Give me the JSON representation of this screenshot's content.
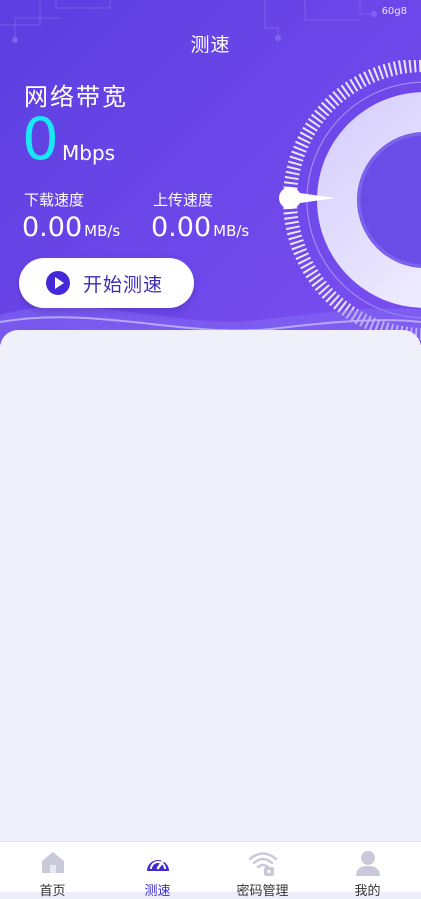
{
  "status": {
    "text": "60g8"
  },
  "header": {
    "title": "测速"
  },
  "bandwidth": {
    "label": "网络带宽",
    "value": "0",
    "unit": "Mbps"
  },
  "download": {
    "label": "下载速度",
    "value": "0.00",
    "unit": "MB/s"
  },
  "upload": {
    "label": "上传速度",
    "value": "0.00",
    "unit": "MB/s"
  },
  "start_button": {
    "label": "开始测速",
    "icon": "play-icon"
  },
  "colors": {
    "accent": "#4529d9",
    "speed": "#19e8f4",
    "hero": "#5a3fe0",
    "active_tab": "#3d2bd0",
    "inactive_icon": "#c9c9d9"
  },
  "tabs": [
    {
      "label": "首页",
      "icon": "home-icon",
      "active": false
    },
    {
      "label": "测速",
      "icon": "speedometer-icon",
      "active": true
    },
    {
      "label": "密码管理",
      "icon": "wifi-lock-icon",
      "active": false
    },
    {
      "label": "我的",
      "icon": "user-icon",
      "active": false
    }
  ]
}
